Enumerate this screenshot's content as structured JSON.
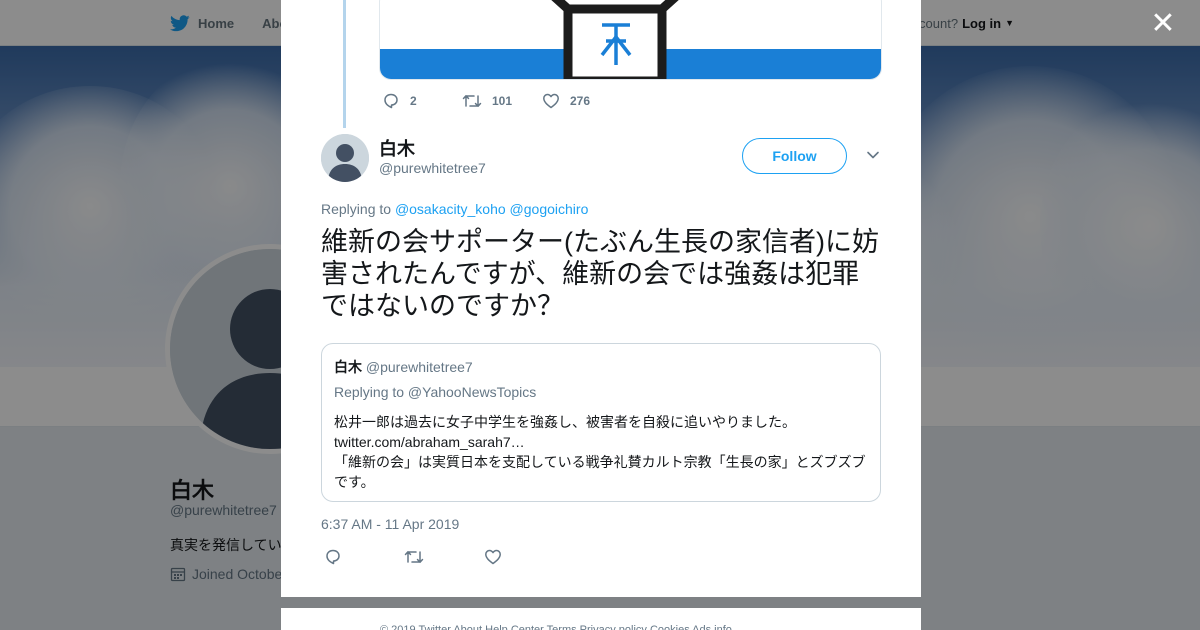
{
  "topbar": {
    "home_label": "Home",
    "about_label": "Abo",
    "account_prompt": "ccount?",
    "login_label": "Log in"
  },
  "profile": {
    "name": "白木",
    "handle": "@purewhitetree7",
    "bio": "真実を発信してい",
    "joined": "Joined Octobe"
  },
  "previous_tweet": {
    "replies": "2",
    "retweets": "101",
    "likes": "276"
  },
  "tweet": {
    "author_name": "白木",
    "author_handle": "@purewhitetree7",
    "follow_label": "Follow",
    "replying_prefix": "Replying to",
    "replying_to_1": "@osakacity_koho",
    "replying_to_2": "@gogoichiro",
    "text": "維新の会サポーター(たぶん生長の家信者)に妨害されたんですが、維新の会では強姦は犯罪ではないのですか？",
    "timestamp": "6:37 AM - 11 Apr 2019"
  },
  "quoted_tweet": {
    "name": "白木",
    "handle": "@purewhitetree7",
    "replying": "Replying to @YahooNewsTopics",
    "line1": "松井一郎は過去に女子中学生を強姦し、被害者を自殺に追いやりました。",
    "line2": "twitter.com/abraham_sarah7…",
    "line3": "「維新の会」は実質日本を支配している戦争礼賛カルト宗教「生長の家」とズブズブです。"
  },
  "footer": {
    "text": "© 2019 Twitter   About   Help Center   Terms   Privacy policy   Cookies   Ads info"
  },
  "colors": {
    "accent": "#1da1f2",
    "muted": "#657786",
    "thread_line": "#b4d4ec"
  }
}
